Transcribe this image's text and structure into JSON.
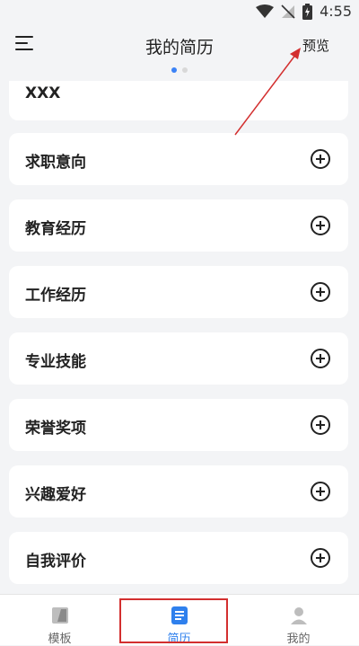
{
  "status": {
    "time": "4:55"
  },
  "header": {
    "title": "我的简历",
    "preview_label": "预览"
  },
  "partial_item": {
    "label": "XXX"
  },
  "sections": [
    {
      "label": "求职意向"
    },
    {
      "label": "教育经历"
    },
    {
      "label": "工作经历"
    },
    {
      "label": "专业技能"
    },
    {
      "label": "荣誉奖项"
    },
    {
      "label": "兴趣爱好"
    },
    {
      "label": "自我评价"
    }
  ],
  "tabs": [
    {
      "label": "模板",
      "icon": "template-icon",
      "active": false
    },
    {
      "label": "简历",
      "icon": "resume-icon",
      "active": true
    },
    {
      "label": "我的",
      "icon": "user-icon",
      "active": false
    }
  ],
  "colors": {
    "accent": "#2f80ed",
    "annotation": "#d32f2f"
  }
}
